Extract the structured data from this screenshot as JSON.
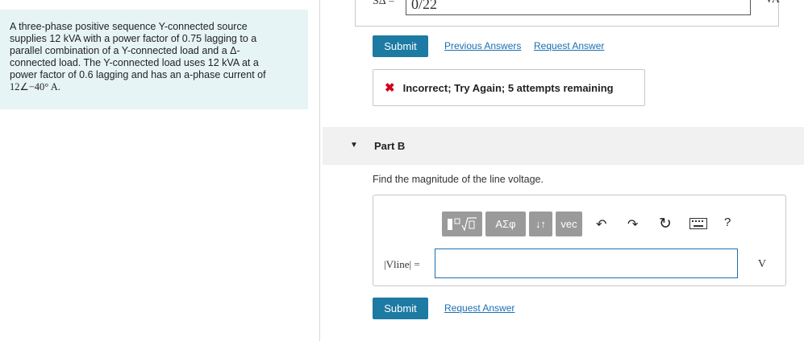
{
  "problem": {
    "lines": [
      "A three-phase positive sequence Y-connected source",
      "supplies 12 kVA with a power factor of 0.75 lagging to a",
      "parallel combination of a Y-connected load and a Δ-",
      "connected load. The Y-connected load uses 12 kVA at a",
      "power factor of 0.6 lagging and has an a-phase current of",
      "12∠−40° A."
    ]
  },
  "part_a": {
    "label": "SΔ =",
    "value": "0/22",
    "unit": "VA",
    "submit_label": "Submit",
    "previous_answers_label": "Previous Answers",
    "request_answer_label": "Request Answer",
    "feedback_icon": "x-mark-icon",
    "feedback_text": "Incorrect; Try Again; 5 attempts remaining",
    "colors": {
      "feedback_icon": "#d0021b",
      "button": "#1c7aa3",
      "link": "#1c6fb0"
    }
  },
  "part_b": {
    "title": "Part B",
    "question": "Find the magnitude of the line voltage.",
    "toolbar": {
      "greek_label": "ΑΣφ",
      "vec_label": "vec",
      "help_label": "?"
    },
    "input_label": "|Vline| =",
    "input_value": "",
    "unit": "V",
    "submit_label": "Submit",
    "request_answer_label": "Request Answer"
  }
}
